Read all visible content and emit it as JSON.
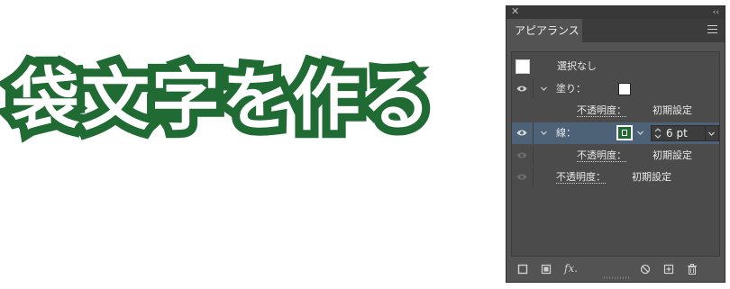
{
  "title_text": "袋文字を作る",
  "colors": {
    "stroke_green": "#1f6b33",
    "panel_bg": "#535353",
    "selected_row": "#4d6276"
  },
  "panel": {
    "tab_label": "アピアランス",
    "rows": {
      "selection_label": "選択なし",
      "fill_label": "塗り：",
      "fill_opacity_label": "不透明度：",
      "fill_opacity_value": "初期設定",
      "stroke_label": "線：",
      "stroke_width_value": "6 pt",
      "stroke_opacity_label": "不透明度：",
      "stroke_opacity_value": "初期設定",
      "object_opacity_label": "不透明度：",
      "object_opacity_value": "初期設定"
    },
    "icons": {
      "close": "close-icon",
      "collapse": "collapse-icon",
      "menu": "panel-menu-icon",
      "new_stroke": "add-new-stroke-icon",
      "new_fill": "add-new-fill-icon",
      "fx": "add-new-effect-icon",
      "clear": "clear-appearance-icon",
      "duplicate": "duplicate-item-icon",
      "delete": "delete-item-icon"
    },
    "fx_label": "fx."
  }
}
